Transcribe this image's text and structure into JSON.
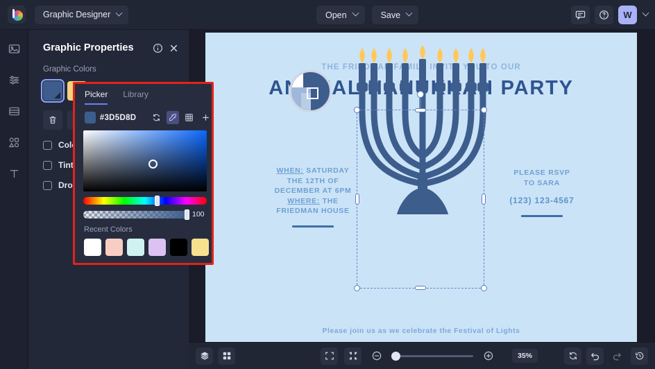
{
  "topbar": {
    "logo_icon": "brand-logo-icon",
    "document_name": "Graphic Designer",
    "open_label": "Open",
    "save_label": "Save",
    "comment_icon": "comment-icon",
    "help_icon": "help-circle-icon",
    "avatar_initial": "W"
  },
  "rail": {
    "items": [
      {
        "icon": "image-icon"
      },
      {
        "icon": "adjustments-icon"
      },
      {
        "icon": "layers-panel-icon"
      },
      {
        "icon": "shapes-icon"
      },
      {
        "icon": "text-tool-icon"
      }
    ]
  },
  "properties": {
    "title": "Graphic Properties",
    "info_icon": "info-icon",
    "close_icon": "close-icon",
    "section_label": "Graphic Colors",
    "swatches": [
      {
        "name": "graphic-color-swatch-blue",
        "color": "#3D5D8D",
        "selected": true
      },
      {
        "name": "graphic-color-swatch-yellow",
        "color": "#F3D47E",
        "selected": false
      }
    ],
    "tools": [
      {
        "icon": "trash-icon"
      },
      {
        "icon": "duplicate-icon"
      }
    ],
    "checkboxes": [
      {
        "label": "Color Overlay",
        "checked": false
      },
      {
        "label": "Tint",
        "checked": false
      },
      {
        "label": "Drop Shadow",
        "checked": false
      }
    ]
  },
  "picker": {
    "tabs": [
      {
        "label": "Picker",
        "active": true
      },
      {
        "label": "Library",
        "active": false
      }
    ],
    "hex_value": "#3D5D8D",
    "swatch_color": "#3D5D8D",
    "actions": [
      {
        "icon": "refresh-icon",
        "active": false
      },
      {
        "icon": "eyedropper-icon",
        "active": true
      },
      {
        "icon": "palette-grid-icon",
        "active": false
      },
      {
        "icon": "plus-icon",
        "active": false
      }
    ],
    "alpha_value": "100",
    "recent_label": "Recent Colors",
    "recent_colors": [
      "#FFFFFF",
      "#F8CEC3",
      "#CFF3F0",
      "#DCC2F2",
      "#000000",
      "#F7E08E"
    ]
  },
  "canvas": {
    "background": "#CBE3F7",
    "eyebrow": "THE FRIEDMAN FAMILY INVITE YOU TO OUR",
    "title": "ANNUAL HANUKKAH PARTY",
    "left_block": "WHEN: SATURDAY\nTHE 12TH OF\nDECEMBER AT 6PM\nWHERE: THE\nFRIEDMAN HOUSE",
    "left_lines": [
      {
        "text": "WHEN:",
        "underline": true,
        "suffix": " SATURDAY"
      },
      {
        "text": "THE 12TH OF",
        "underline": false,
        "suffix": ""
      },
      {
        "text": "DECEMBER AT 6PM",
        "underline": false,
        "suffix": ""
      },
      {
        "text": "WHERE:",
        "underline": true,
        "suffix": " THE"
      },
      {
        "text": "FRIEDMAN HOUSE",
        "underline": false,
        "suffix": ""
      }
    ],
    "right_line1": "PLEASE RSVP",
    "right_line2": "TO SARA",
    "phone": "(123) 123-4567",
    "footer": "Please join us as we celebrate the Festival of Lights",
    "graphic_name": "menorah-graphic",
    "menorah_color": "#3D5D8D",
    "flame_color": "#FFC858",
    "flame_color_light": "#FFE08A"
  },
  "bottombar": {
    "layers_icon": "layers-icon",
    "grid_icon": "grid-view-icon",
    "fit_icon": "fit-to-screen-icon",
    "shrink_icon": "zoom-fit-icon",
    "zoom_out_icon": "zoom-out-icon",
    "zoom_in_icon": "zoom-in-icon",
    "zoom_value": "35%",
    "reset_icon": "reset-icon",
    "undo_icon": "undo-icon",
    "redo_icon": "redo-icon",
    "history_icon": "history-icon"
  }
}
